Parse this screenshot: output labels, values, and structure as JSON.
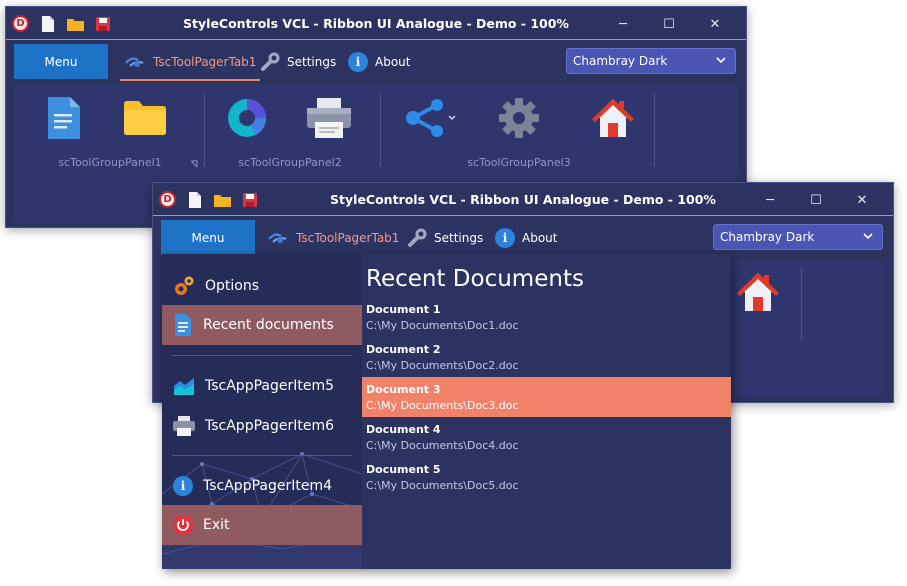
{
  "windows": [
    {
      "title": "StyleControls VCL - Ribbon UI Analogue - Demo - 100%",
      "controls": {
        "minimize": "─",
        "maximize": "☐",
        "close": "✕"
      },
      "menu_label": "Menu",
      "tabs": [
        {
          "label": "TscToolPagerTab1",
          "icon": "ribbon-tab-icon",
          "active": true
        },
        {
          "label": "Settings",
          "icon": "wrench-icon"
        },
        {
          "label": "About",
          "icon": "info-icon"
        }
      ],
      "theme_combo": "Chambray Dark",
      "groups": [
        "scToolGroupPanel1",
        "scToolGroupPanel2",
        "scToolGroupPanel3"
      ]
    },
    {
      "title": "StyleControls VCL - Ribbon UI Analogue - Demo - 100%",
      "controls": {
        "minimize": "─",
        "maximize": "☐",
        "close": "✕"
      },
      "menu_label": "Menu",
      "tabs": [
        {
          "label": "TscToolPagerTab1",
          "icon": "ribbon-tab-icon",
          "active": true
        },
        {
          "label": "Settings",
          "icon": "wrench-icon"
        },
        {
          "label": "About",
          "icon": "info-icon"
        }
      ],
      "theme_combo": "Chambray Dark"
    }
  ],
  "app_menu": {
    "items": [
      {
        "label": "Options",
        "icon": "gears-icon"
      },
      {
        "label": "Recent documents",
        "icon": "document-icon",
        "selected": true
      },
      {
        "label": "TscAppPagerItem5",
        "icon": "chart-icon"
      },
      {
        "label": "TscAppPagerItem6",
        "icon": "printer-icon"
      },
      {
        "label": "TscAppPagerItem4",
        "icon": "info-icon"
      },
      {
        "label": "Exit",
        "icon": "power-icon"
      }
    ],
    "recent_title": "Recent Documents",
    "documents": [
      {
        "name": "Document 1",
        "path": "C:\\My Documents\\Doc1.doc"
      },
      {
        "name": "Document 2",
        "path": "C:\\My Documents\\Doc2.doc"
      },
      {
        "name": "Document 3",
        "path": "C:\\My Documents\\Doc3.doc",
        "selected": true
      },
      {
        "name": "Document 4",
        "path": "C:\\My Documents\\Doc4.doc"
      },
      {
        "name": "Document 5",
        "path": "C:\\My Documents\\Doc5.doc"
      }
    ]
  },
  "colors": {
    "accent": "#e7846a",
    "menu_button": "#1f73c7",
    "selected_doc": "#f0826a",
    "window_bg": "#2d3361"
  }
}
